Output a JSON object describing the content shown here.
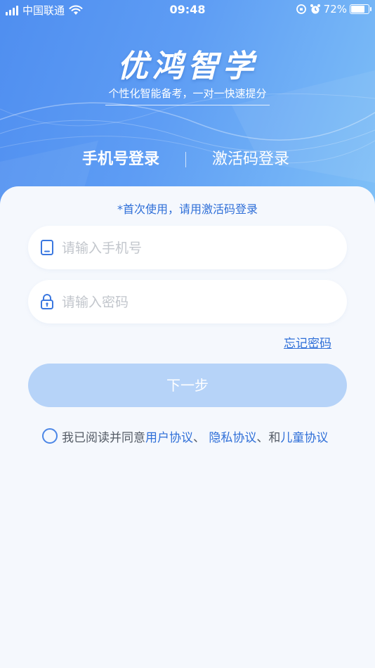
{
  "status_bar": {
    "carrier": "中国联通",
    "time": "09:48",
    "battery": "72%",
    "battery_level": 0.72,
    "signal_icon": "signal-bars-icon",
    "wifi_icon": "wifi-icon",
    "lock_icon": "orientation-lock-icon",
    "alarm_icon": "alarm-clock-icon"
  },
  "brand": {
    "title": "优鸿智学",
    "slogan": "个性化智能备考，一对一快速提分"
  },
  "tabs": [
    {
      "label": "手机号登录",
      "active": true
    },
    {
      "label": "激活码登录",
      "active": false
    }
  ],
  "tab_divider": "|",
  "notice": "*首次使用，请用激活码登录",
  "phone_field": {
    "placeholder": "请输入手机号",
    "icon": "phone-icon"
  },
  "password_field": {
    "placeholder": "请输入密码",
    "icon": "lock-icon"
  },
  "forgot_password": "忘记密码",
  "next_button": "下一步",
  "agreement": {
    "prefix": "我已阅读并同意",
    "user_agreement": "用户协议",
    "sep1": "、 ",
    "privacy_agreement": "隐私协议",
    "sep2": "、和",
    "child_agreement": "儿童协议",
    "checked": false
  },
  "colors": {
    "accent": "#2f6fd8",
    "button_disabled": "#b6d3f8",
    "hero_start": "#4f8ef0",
    "hero_end": "#7fc0f7",
    "background": "#f5f8fd"
  }
}
